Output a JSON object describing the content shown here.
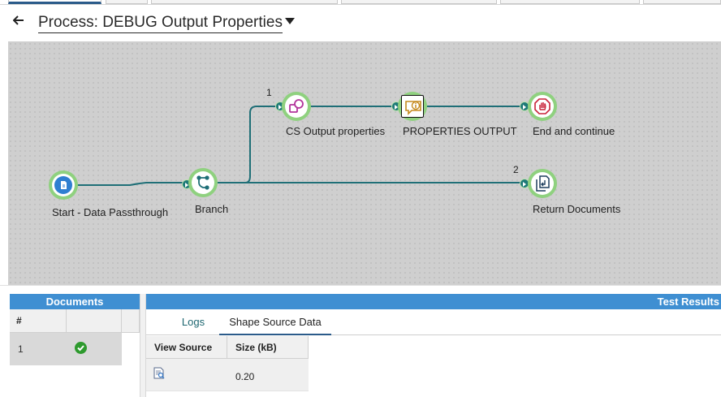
{
  "header": {
    "back_icon": "arrow-left-icon",
    "title": "Process: DEBUG Output Properties",
    "caret_icon": "caret-down-icon"
  },
  "canvas": {
    "shapes": [
      {
        "id": "start",
        "label": "Start - Data Passthrough",
        "icon": "document-icon"
      },
      {
        "id": "branch",
        "label": "Branch",
        "icon": "branch-icon"
      },
      {
        "id": "cs",
        "label": "CS Output properties",
        "icon": "shapes-icon"
      },
      {
        "id": "props",
        "label": "PROPERTIES OUTPUT",
        "icon": "message-info-icon"
      },
      {
        "id": "end",
        "label": "End and continue",
        "icon": "stop-hand-icon"
      },
      {
        "id": "return",
        "label": "Return Documents",
        "icon": "return-documents-icon"
      }
    ],
    "branch_numbers": [
      "1",
      "2"
    ],
    "colors": {
      "halo": "#8fd17f",
      "wire": "#1f6f77",
      "canvas_bg": "#cfcfcf"
    }
  },
  "documents_panel": {
    "title": "Documents",
    "columns": [
      "#",
      ""
    ],
    "rows": [
      {
        "num": "1",
        "status_icon": "check-circle-icon"
      }
    ]
  },
  "results_panel": {
    "title": "Test Results",
    "tabs": [
      "Logs",
      "Shape Source Data"
    ],
    "active_tab": "Shape Source Data",
    "columns": [
      "View Source",
      "Size (kB)"
    ],
    "rows": [
      {
        "view_icon": "document-view-icon",
        "size": "0.20"
      }
    ]
  },
  "theme": {
    "accent": "#3f8fd2",
    "tab_underline": "#2b5b8a"
  }
}
